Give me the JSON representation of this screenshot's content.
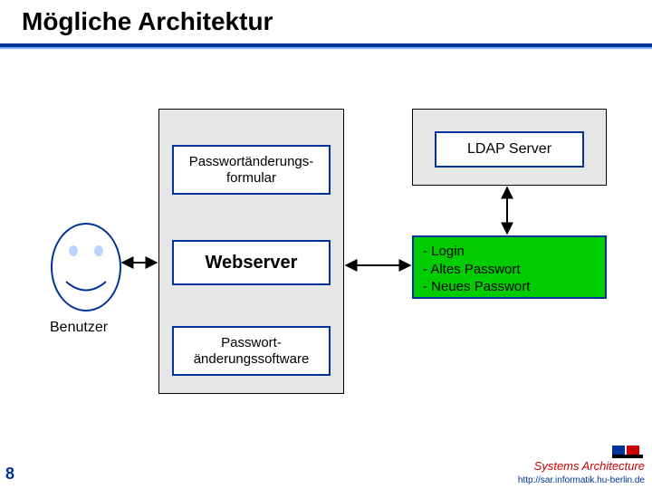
{
  "title": "Mögliche Architektur",
  "pageNumber": "8",
  "user": {
    "label": "Benutzer"
  },
  "webserver": {
    "formBox": "Passwortänderungs-\nformular",
    "label": "Webserver",
    "softwareBox": "Passwort-\nänderungssoftware"
  },
  "ldap": {
    "label": "LDAP Server"
  },
  "payload": "- Login\n- Altes Passwort\n- Neues Passwort",
  "footer": {
    "brand": "Systems Architecture",
    "url": "http://sar.informatik.hu-berlin.de"
  }
}
